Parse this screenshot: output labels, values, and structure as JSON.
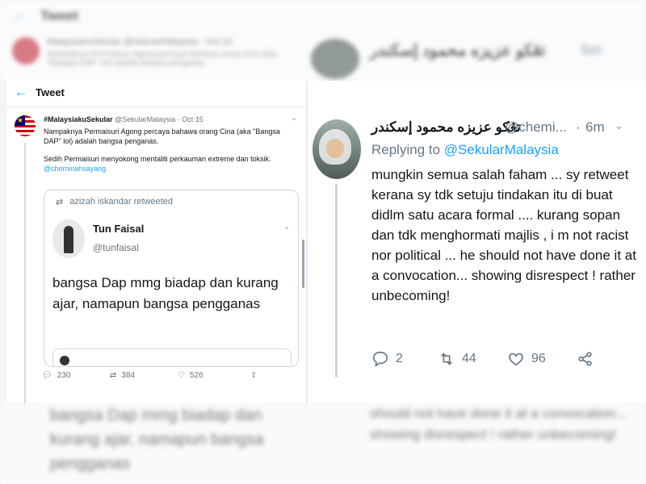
{
  "background": {
    "top": {
      "title": "Tweet",
      "line1": "MalaysiakuSekular @SekularMalaysia · Oct 15",
      "line2": "Nampaknya Permaisuri Agong percaya bahawa orang Cina (aka \"Bangsa DAP\" lol) adalah bangsa penganas.",
      "name": "تڠكو عزيزه محمود إسكندر",
      "handle": "@chemi...",
      "time": "6m"
    },
    "bottom": {
      "left": "bangsa Dap mmg biadap dan kurang ajar, namapun bangsa pengganas",
      "right": "should not have done it at a convocation... showing disrespect ! rather unbecoming!"
    }
  },
  "left_panel": {
    "header": {
      "back": "←",
      "title": "Tweet"
    },
    "tweet": {
      "name": "#MalaysiakuSekular",
      "handle": "@SekularMalaysia",
      "date": "· Oct 15",
      "text1": "Nampaknya Permaisuri Agong percaya bahawa orang Cina (aka \"Bangsa DAP\" lol) adalah bangsa penganas.",
      "text2": "Sedih Permaisuri menyokong mentaliti perkauman extreme dan toksik.",
      "mention": "@cheminahsayang",
      "quote": {
        "retweeted_by": "azizah iskandar retweeted",
        "name": "Tun Faisal",
        "handle": "@tunfaisal",
        "text": "bangsa Dap mmg biadap dan kurang ajar, namapun bangsa pengganas"
      },
      "actions": {
        "replies": "230",
        "retweets": "384",
        "likes": "526"
      }
    }
  },
  "right_panel": {
    "name": "تڠكو عزيزه محمود إسكندر",
    "handle": "@chemi...",
    "dot": "·",
    "time": "6m",
    "replying_prefix": "Replying to",
    "replying_to": "@SekularMalaysia",
    "text": "mungkin semua salah faham ... sy retweet kerana sy tdk setuju tindakan itu di buat didlm satu acara formal .... kurang sopan dan tdk menghormati majlis , i m not racist nor political ... he should not have done it at a convocation... showing disrespect ! rather unbecoming!",
    "actions": {
      "replies": "2",
      "retweets": "44",
      "likes": "96"
    }
  },
  "colors": {
    "accent": "#1da1f2",
    "muted": "#657786",
    "text": "#14171a"
  }
}
